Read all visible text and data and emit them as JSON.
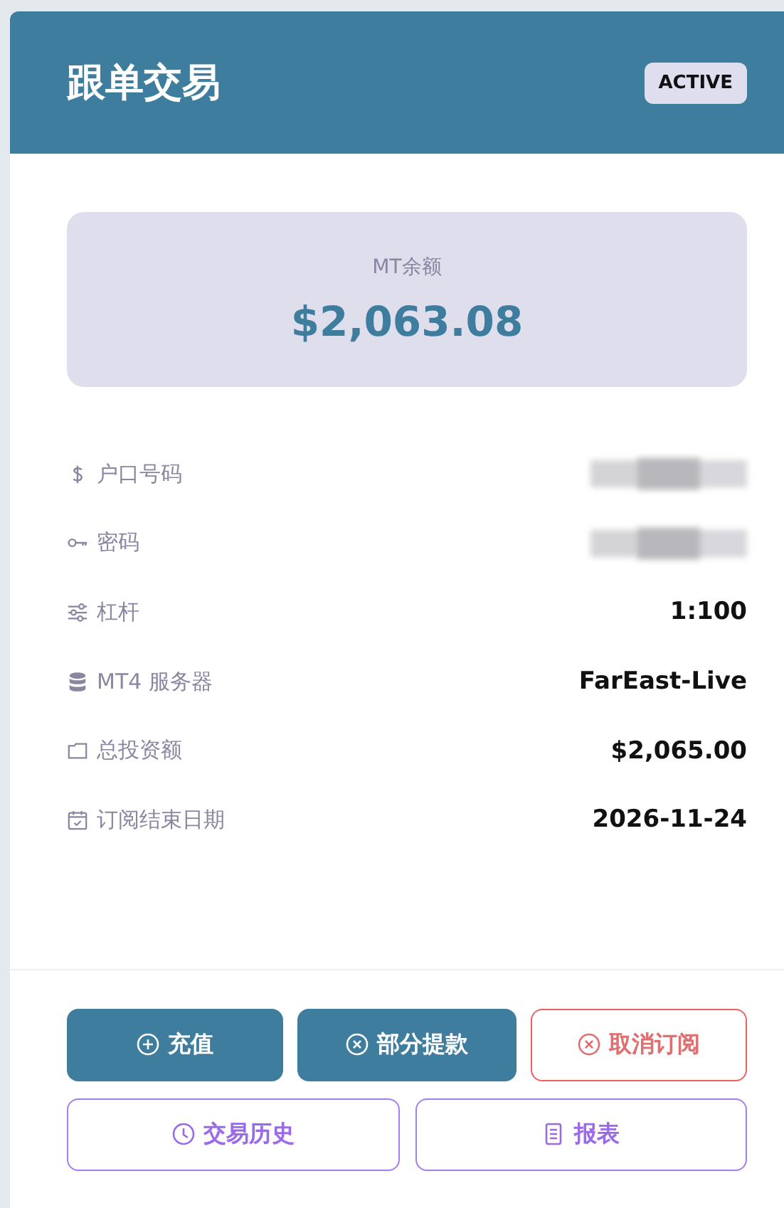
{
  "header": {
    "title": "跟单交易",
    "status": "ACTIVE"
  },
  "balance": {
    "label": "MT余额",
    "value": "$2,063.08"
  },
  "details": [
    {
      "label": "户口号码",
      "masked": true
    },
    {
      "label": "密码",
      "masked": true
    },
    {
      "label": "杠杆",
      "value": "1:100",
      "masked": false
    },
    {
      "label": "MT4 服务器",
      "value": "FarEast-Live",
      "masked": false
    },
    {
      "label": "总投资额",
      "value": "$2,065.00",
      "masked": false
    },
    {
      "label": "订阅结束日期",
      "value": "2026-11-24",
      "masked": false
    }
  ],
  "actions": [
    {
      "label": "充值",
      "kind": "primary"
    },
    {
      "label": "部分提款",
      "kind": "primary"
    },
    {
      "label": "取消订阅",
      "kind": "danger"
    },
    {
      "label": "交易历史",
      "kind": "outline"
    },
    {
      "label": "报表",
      "kind": "outline"
    }
  ]
}
